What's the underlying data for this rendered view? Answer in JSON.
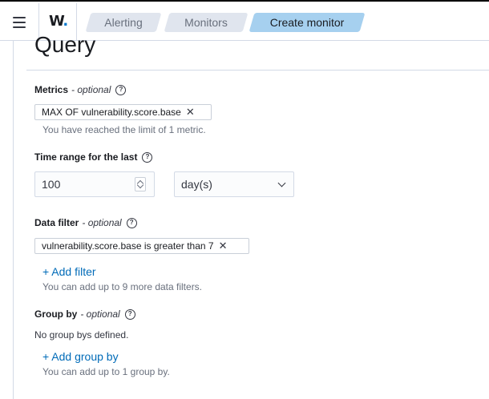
{
  "header": {
    "logo_text": "W",
    "logo_dot": ".",
    "breadcrumbs": [
      "Alerting",
      "Monitors",
      "Create monitor"
    ]
  },
  "section": {
    "title": "Query"
  },
  "metrics": {
    "label": "Metrics",
    "optional": "- optional",
    "selected": "MAX OF vulnerability.score.base",
    "help": "You have reached the limit of 1 metric."
  },
  "time_range": {
    "label": "Time range for the last",
    "value": "100",
    "unit": "day(s)"
  },
  "data_filter": {
    "label": "Data filter",
    "optional": "- optional",
    "filter": "vulnerability.score.base is greater than 7",
    "add_label": "+ Add filter",
    "help": "You can add up to 9 more data filters."
  },
  "group_by": {
    "label": "Group by",
    "optional": "- optional",
    "empty": "No group bys defined.",
    "add_label": "+ Add group by",
    "help": "You can add up to 1 group by."
  },
  "icons": {
    "menu": "menu-icon",
    "help": "question-circle-icon",
    "remove": "close-icon",
    "chevron": "chevron-down-icon"
  },
  "colors": {
    "accent": "#006bb8",
    "active_crumb": "#a6d0ef",
    "logo_dot": "#0077cc"
  }
}
